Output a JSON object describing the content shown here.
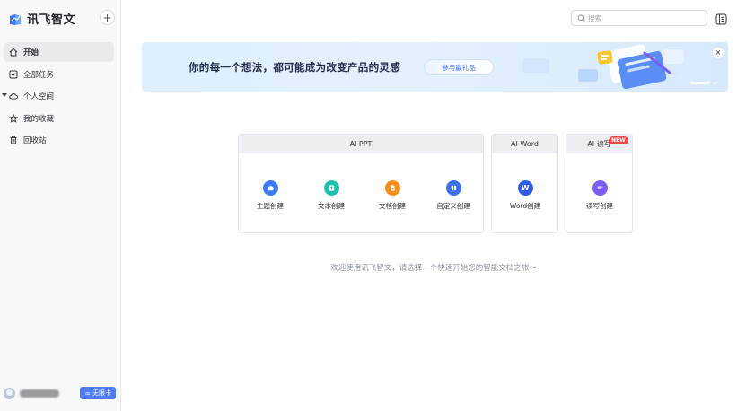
{
  "app": {
    "name": "讯飞智文"
  },
  "sidebar": {
    "add_label": "+",
    "items": [
      {
        "label": "开始",
        "icon": "home-icon",
        "active": true
      },
      {
        "label": "全部任务",
        "icon": "task-check-icon"
      },
      {
        "label": "个人空间",
        "icon": "cloud-icon",
        "expandable": true
      },
      {
        "label": "我的收藏",
        "icon": "star-icon"
      },
      {
        "label": "回收站",
        "icon": "trash-icon"
      }
    ],
    "user": {
      "badge": "无限卡",
      "badge_icon": "infinity-icon"
    }
  },
  "topbar": {
    "search_placeholder": "搜索",
    "panel_icon": "panel-layout-icon"
  },
  "banner": {
    "title": "你的每一个想法，都可能成为改变产品的灵感",
    "button": "参与赢礼品",
    "close": "×"
  },
  "cards": {
    "ppt": {
      "title": "AI PPT",
      "tools": [
        {
          "label": "主题创建",
          "icon": "puzzle-icon",
          "color": "#3d7bf5"
        },
        {
          "label": "文本创建",
          "icon": "text-doc-icon",
          "color": "#1fbfae"
        },
        {
          "label": "文档创建",
          "icon": "file-icon",
          "color": "#f38d1c"
        },
        {
          "label": "自定义创建",
          "icon": "grid-icon",
          "color": "#3a6ff0"
        }
      ]
    },
    "word": {
      "title": "AI Word",
      "tools": [
        {
          "label": "Word创建",
          "icon": "word-icon",
          "glyph": "W",
          "color": "#2d5be3"
        }
      ]
    },
    "write": {
      "title": "AI 读写",
      "badge": "NEW",
      "tools": [
        {
          "label": "读写创建",
          "icon": "write-icon",
          "color": "#7b5cf0"
        }
      ]
    }
  },
  "welcome": "欢迎使用讯飞智文，请选择一个快速开始您的智能文档之旅～"
}
